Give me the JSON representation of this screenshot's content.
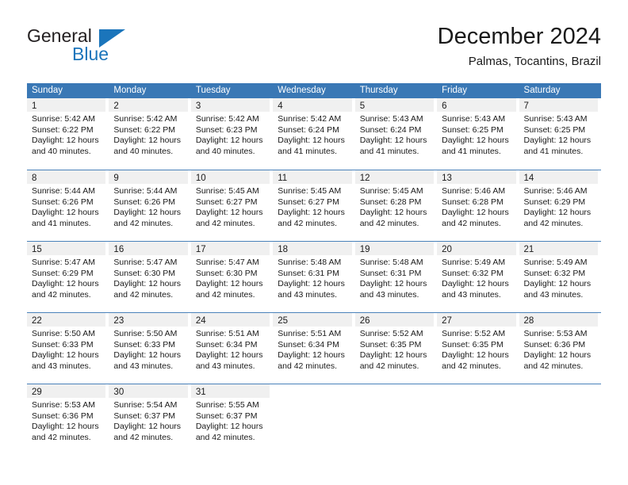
{
  "brand": {
    "name_part1": "General",
    "name_part2": "Blue",
    "colors": {
      "blue": "#1b75bb",
      "dark": "#231f20"
    }
  },
  "header": {
    "title": "December 2024",
    "subtitle": "Palmas, Tocantins, Brazil"
  },
  "calendar": {
    "header_bg": "#3a78b5",
    "daynum_bg": "#f0f0f0",
    "row_divider": "#4a82ba",
    "weekdays": [
      "Sunday",
      "Monday",
      "Tuesday",
      "Wednesday",
      "Thursday",
      "Friday",
      "Saturday"
    ],
    "weeks": [
      [
        {
          "day": "1",
          "sunrise": "Sunrise: 5:42 AM",
          "sunset": "Sunset: 6:22 PM",
          "daylight1": "Daylight: 12 hours",
          "daylight2": "and 40 minutes."
        },
        {
          "day": "2",
          "sunrise": "Sunrise: 5:42 AM",
          "sunset": "Sunset: 6:22 PM",
          "daylight1": "Daylight: 12 hours",
          "daylight2": "and 40 minutes."
        },
        {
          "day": "3",
          "sunrise": "Sunrise: 5:42 AM",
          "sunset": "Sunset: 6:23 PM",
          "daylight1": "Daylight: 12 hours",
          "daylight2": "and 40 minutes."
        },
        {
          "day": "4",
          "sunrise": "Sunrise: 5:42 AM",
          "sunset": "Sunset: 6:24 PM",
          "daylight1": "Daylight: 12 hours",
          "daylight2": "and 41 minutes."
        },
        {
          "day": "5",
          "sunrise": "Sunrise: 5:43 AM",
          "sunset": "Sunset: 6:24 PM",
          "daylight1": "Daylight: 12 hours",
          "daylight2": "and 41 minutes."
        },
        {
          "day": "6",
          "sunrise": "Sunrise: 5:43 AM",
          "sunset": "Sunset: 6:25 PM",
          "daylight1": "Daylight: 12 hours",
          "daylight2": "and 41 minutes."
        },
        {
          "day": "7",
          "sunrise": "Sunrise: 5:43 AM",
          "sunset": "Sunset: 6:25 PM",
          "daylight1": "Daylight: 12 hours",
          "daylight2": "and 41 minutes."
        }
      ],
      [
        {
          "day": "8",
          "sunrise": "Sunrise: 5:44 AM",
          "sunset": "Sunset: 6:26 PM",
          "daylight1": "Daylight: 12 hours",
          "daylight2": "and 41 minutes."
        },
        {
          "day": "9",
          "sunrise": "Sunrise: 5:44 AM",
          "sunset": "Sunset: 6:26 PM",
          "daylight1": "Daylight: 12 hours",
          "daylight2": "and 42 minutes."
        },
        {
          "day": "10",
          "sunrise": "Sunrise: 5:45 AM",
          "sunset": "Sunset: 6:27 PM",
          "daylight1": "Daylight: 12 hours",
          "daylight2": "and 42 minutes."
        },
        {
          "day": "11",
          "sunrise": "Sunrise: 5:45 AM",
          "sunset": "Sunset: 6:27 PM",
          "daylight1": "Daylight: 12 hours",
          "daylight2": "and 42 minutes."
        },
        {
          "day": "12",
          "sunrise": "Sunrise: 5:45 AM",
          "sunset": "Sunset: 6:28 PM",
          "daylight1": "Daylight: 12 hours",
          "daylight2": "and 42 minutes."
        },
        {
          "day": "13",
          "sunrise": "Sunrise: 5:46 AM",
          "sunset": "Sunset: 6:28 PM",
          "daylight1": "Daylight: 12 hours",
          "daylight2": "and 42 minutes."
        },
        {
          "day": "14",
          "sunrise": "Sunrise: 5:46 AM",
          "sunset": "Sunset: 6:29 PM",
          "daylight1": "Daylight: 12 hours",
          "daylight2": "and 42 minutes."
        }
      ],
      [
        {
          "day": "15",
          "sunrise": "Sunrise: 5:47 AM",
          "sunset": "Sunset: 6:29 PM",
          "daylight1": "Daylight: 12 hours",
          "daylight2": "and 42 minutes."
        },
        {
          "day": "16",
          "sunrise": "Sunrise: 5:47 AM",
          "sunset": "Sunset: 6:30 PM",
          "daylight1": "Daylight: 12 hours",
          "daylight2": "and 42 minutes."
        },
        {
          "day": "17",
          "sunrise": "Sunrise: 5:47 AM",
          "sunset": "Sunset: 6:30 PM",
          "daylight1": "Daylight: 12 hours",
          "daylight2": "and 42 minutes."
        },
        {
          "day": "18",
          "sunrise": "Sunrise: 5:48 AM",
          "sunset": "Sunset: 6:31 PM",
          "daylight1": "Daylight: 12 hours",
          "daylight2": "and 43 minutes."
        },
        {
          "day": "19",
          "sunrise": "Sunrise: 5:48 AM",
          "sunset": "Sunset: 6:31 PM",
          "daylight1": "Daylight: 12 hours",
          "daylight2": "and 43 minutes."
        },
        {
          "day": "20",
          "sunrise": "Sunrise: 5:49 AM",
          "sunset": "Sunset: 6:32 PM",
          "daylight1": "Daylight: 12 hours",
          "daylight2": "and 43 minutes."
        },
        {
          "day": "21",
          "sunrise": "Sunrise: 5:49 AM",
          "sunset": "Sunset: 6:32 PM",
          "daylight1": "Daylight: 12 hours",
          "daylight2": "and 43 minutes."
        }
      ],
      [
        {
          "day": "22",
          "sunrise": "Sunrise: 5:50 AM",
          "sunset": "Sunset: 6:33 PM",
          "daylight1": "Daylight: 12 hours",
          "daylight2": "and 43 minutes."
        },
        {
          "day": "23",
          "sunrise": "Sunrise: 5:50 AM",
          "sunset": "Sunset: 6:33 PM",
          "daylight1": "Daylight: 12 hours",
          "daylight2": "and 43 minutes."
        },
        {
          "day": "24",
          "sunrise": "Sunrise: 5:51 AM",
          "sunset": "Sunset: 6:34 PM",
          "daylight1": "Daylight: 12 hours",
          "daylight2": "and 43 minutes."
        },
        {
          "day": "25",
          "sunrise": "Sunrise: 5:51 AM",
          "sunset": "Sunset: 6:34 PM",
          "daylight1": "Daylight: 12 hours",
          "daylight2": "and 42 minutes."
        },
        {
          "day": "26",
          "sunrise": "Sunrise: 5:52 AM",
          "sunset": "Sunset: 6:35 PM",
          "daylight1": "Daylight: 12 hours",
          "daylight2": "and 42 minutes."
        },
        {
          "day": "27",
          "sunrise": "Sunrise: 5:52 AM",
          "sunset": "Sunset: 6:35 PM",
          "daylight1": "Daylight: 12 hours",
          "daylight2": "and 42 minutes."
        },
        {
          "day": "28",
          "sunrise": "Sunrise: 5:53 AM",
          "sunset": "Sunset: 6:36 PM",
          "daylight1": "Daylight: 12 hours",
          "daylight2": "and 42 minutes."
        }
      ],
      [
        {
          "day": "29",
          "sunrise": "Sunrise: 5:53 AM",
          "sunset": "Sunset: 6:36 PM",
          "daylight1": "Daylight: 12 hours",
          "daylight2": "and 42 minutes."
        },
        {
          "day": "30",
          "sunrise": "Sunrise: 5:54 AM",
          "sunset": "Sunset: 6:37 PM",
          "daylight1": "Daylight: 12 hours",
          "daylight2": "and 42 minutes."
        },
        {
          "day": "31",
          "sunrise": "Sunrise: 5:55 AM",
          "sunset": "Sunset: 6:37 PM",
          "daylight1": "Daylight: 12 hours",
          "daylight2": "and 42 minutes."
        },
        {
          "day": "",
          "sunrise": "",
          "sunset": "",
          "daylight1": "",
          "daylight2": ""
        },
        {
          "day": "",
          "sunrise": "",
          "sunset": "",
          "daylight1": "",
          "daylight2": ""
        },
        {
          "day": "",
          "sunrise": "",
          "sunset": "",
          "daylight1": "",
          "daylight2": ""
        },
        {
          "day": "",
          "sunrise": "",
          "sunset": "",
          "daylight1": "",
          "daylight2": ""
        }
      ]
    ]
  }
}
